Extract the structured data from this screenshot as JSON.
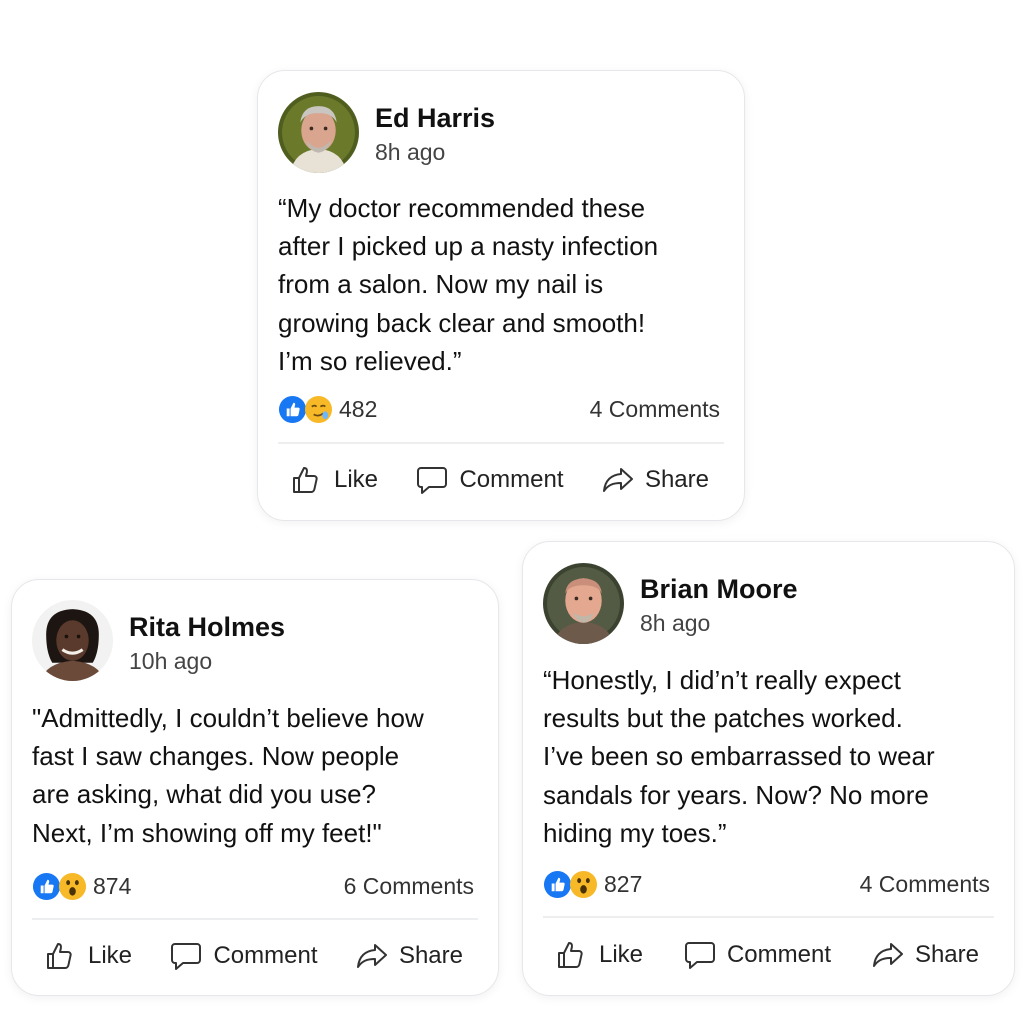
{
  "colors": {
    "like_blue": "#1877f2",
    "emoji_yellow": "#f7b928",
    "text": "#1c1e21"
  },
  "posts": [
    {
      "author": "Ed Harris",
      "time": "8h ago",
      "quote_lines": [
        "“My doctor recommended these",
        "after I picked up a nasty infection",
        "from a salon. Now my nail is",
        "growing back clear and smooth!",
        "I’m so relieved.”"
      ],
      "reaction_icons": [
        "like-icon",
        "relieved-face-icon"
      ],
      "reaction_count": "482",
      "comments": "4 Comments",
      "actions": {
        "like": "Like",
        "comment": "Comment",
        "share": "Share"
      }
    },
    {
      "author": "Rita Holmes",
      "time": "10h ago",
      "quote_lines": [
        "\"Admittedly, I couldn’t believe how",
        "fast I saw changes. Now people",
        "are asking, what did you use?",
        "Next, I’m showing off my feet!\""
      ],
      "reaction_icons": [
        "like-icon",
        "wow-icon"
      ],
      "reaction_count": "874",
      "comments": "6 Comments",
      "actions": {
        "like": "Like",
        "comment": "Comment",
        "share": "Share"
      }
    },
    {
      "author": "Brian Moore",
      "time": "8h ago",
      "quote_lines": [
        "“Honestly, I did’n’t really expect",
        "results but the patches worked.",
        "I’ve been so embarrassed to wear",
        "sandals for years. Now? No more",
        "hiding my toes.”"
      ],
      "reaction_icons": [
        "like-icon",
        "wow-icon"
      ],
      "reaction_count": "827",
      "comments": "4 Comments",
      "actions": {
        "like": "Like",
        "comment": "Comment",
        "share": "Share"
      }
    }
  ]
}
